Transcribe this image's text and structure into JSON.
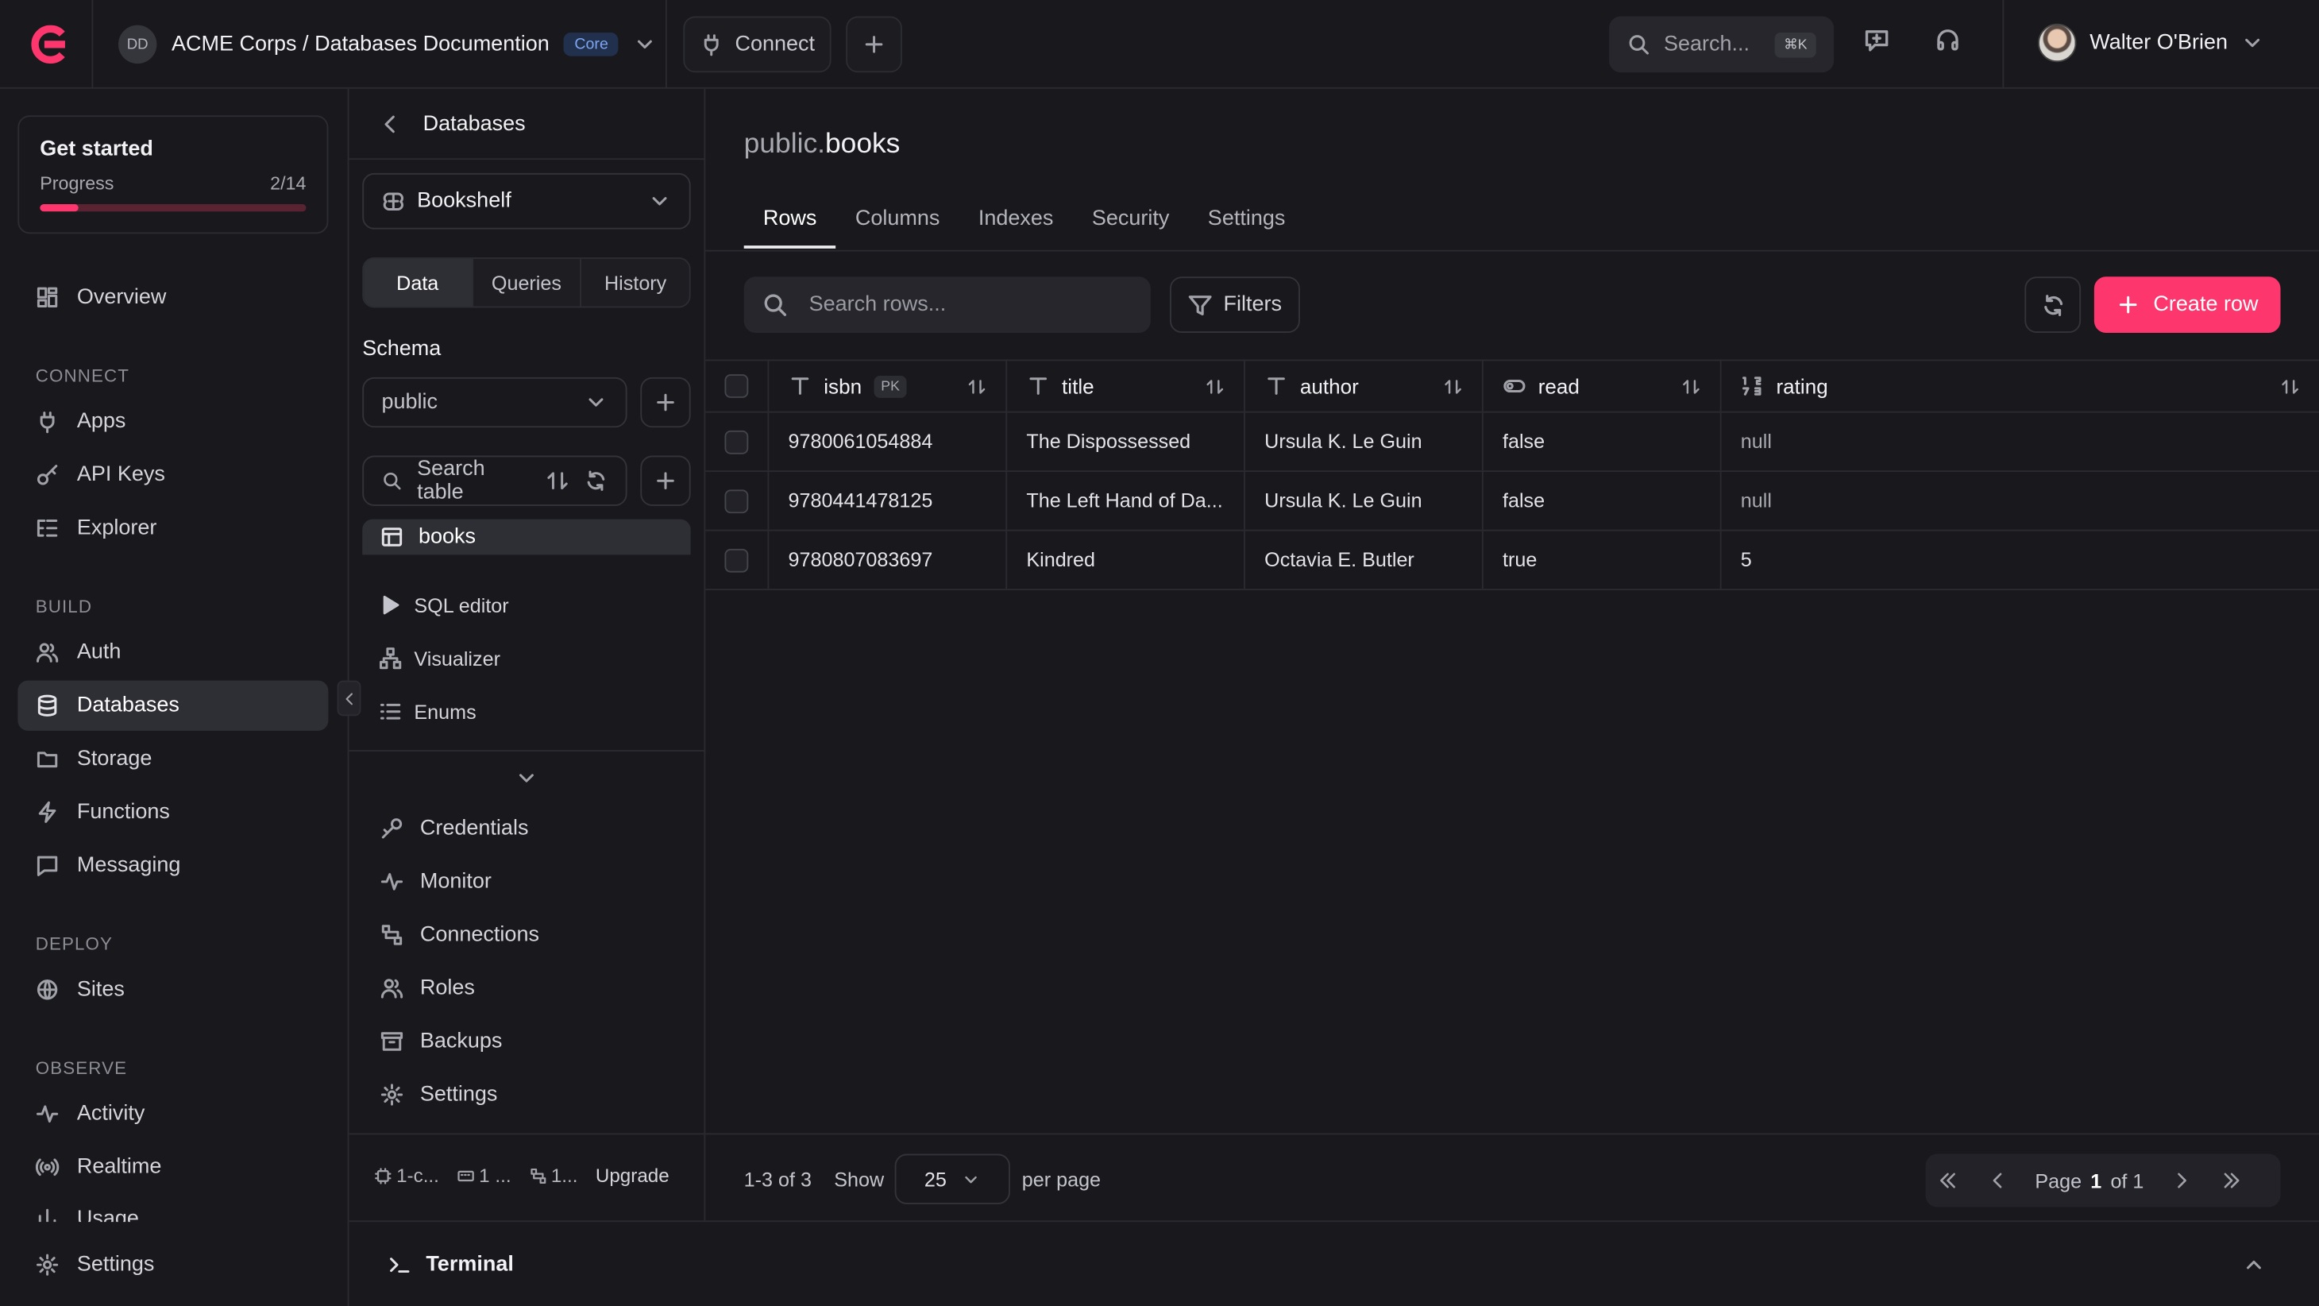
{
  "header": {
    "org_initials": "DD",
    "org_title": "ACME Corps / Databases Documention",
    "plan_badge": "Core",
    "connect_label": "Connect",
    "search_placeholder": "Search...",
    "search_shortcut": "⌘K",
    "user_name": "Walter O'Brien",
    "brand_color": "#fd366e"
  },
  "get_started": {
    "title": "Get started",
    "progress_label": "Progress",
    "progress_text": "2/14",
    "progress_fraction": 0.1429
  },
  "sidebar": {
    "sections": {
      "connect": "CONNECT",
      "build": "BUILD",
      "deploy": "DEPLOY",
      "observe": "OBSERVE"
    },
    "items": {
      "overview": "Overview",
      "apps": "Apps",
      "api_keys": "API Keys",
      "explorer": "Explorer",
      "auth": "Auth",
      "databases": "Databases",
      "storage": "Storage",
      "functions": "Functions",
      "messaging": "Messaging",
      "sites": "Sites",
      "activity": "Activity",
      "realtime": "Realtime",
      "usage": "Usage",
      "settings": "Settings"
    }
  },
  "panel": {
    "back_title": "Databases",
    "database_name": "Bookshelf",
    "segments": [
      "Data",
      "Queries",
      "History"
    ],
    "schema_label": "Schema",
    "schema_value": "public",
    "search_table_placeholder": "Search table",
    "table_name": "books",
    "tools": {
      "sql_editor": "SQL editor",
      "visualizer": "Visualizer",
      "enums": "Enums"
    },
    "links": {
      "credentials": "Credentials",
      "monitor": "Monitor",
      "connections": "Connections",
      "roles": "Roles",
      "backups": "Backups",
      "settings": "Settings"
    },
    "usage": {
      "cpu": "1-c...",
      "memory": "1 ...",
      "connections": "1...",
      "upgrade": "Upgrade"
    }
  },
  "main": {
    "title_schema": "public.",
    "title_table": "books",
    "tabs": [
      "Rows",
      "Columns",
      "Indexes",
      "Security",
      "Settings"
    ],
    "search_rows_placeholder": "Search rows...",
    "filters_label": "Filters",
    "create_row_label": "Create row",
    "columns": [
      {
        "name": "isbn",
        "type_icon": "text-type-icon",
        "badge": "PK"
      },
      {
        "name": "title",
        "type_icon": "text-type-icon"
      },
      {
        "name": "author",
        "type_icon": "text-type-icon"
      },
      {
        "name": "read",
        "type_icon": "boolean-type-icon"
      },
      {
        "name": "rating",
        "type_icon": "integer-type-icon"
      }
    ],
    "rows": [
      {
        "isbn": "9780061054884",
        "title": "The Dispossessed",
        "author": "Ursula K. Le Guin",
        "read": "false",
        "rating": "null"
      },
      {
        "isbn": "9780441478125",
        "title": "The Left Hand of Da...",
        "author": "Ursula K. Le Guin",
        "read": "false",
        "rating": "null"
      },
      {
        "isbn": "9780807083697",
        "title": "Kindred",
        "author": "Octavia E. Butler",
        "read": "true",
        "rating": "5"
      }
    ],
    "footer": {
      "count": "1-3 of 3",
      "show_label": "Show",
      "per_page_value": "25",
      "per_page_label": "per page",
      "page_label": "Page",
      "page_current": "1",
      "page_of": "of 1"
    }
  },
  "terminal": {
    "label": "Terminal"
  }
}
